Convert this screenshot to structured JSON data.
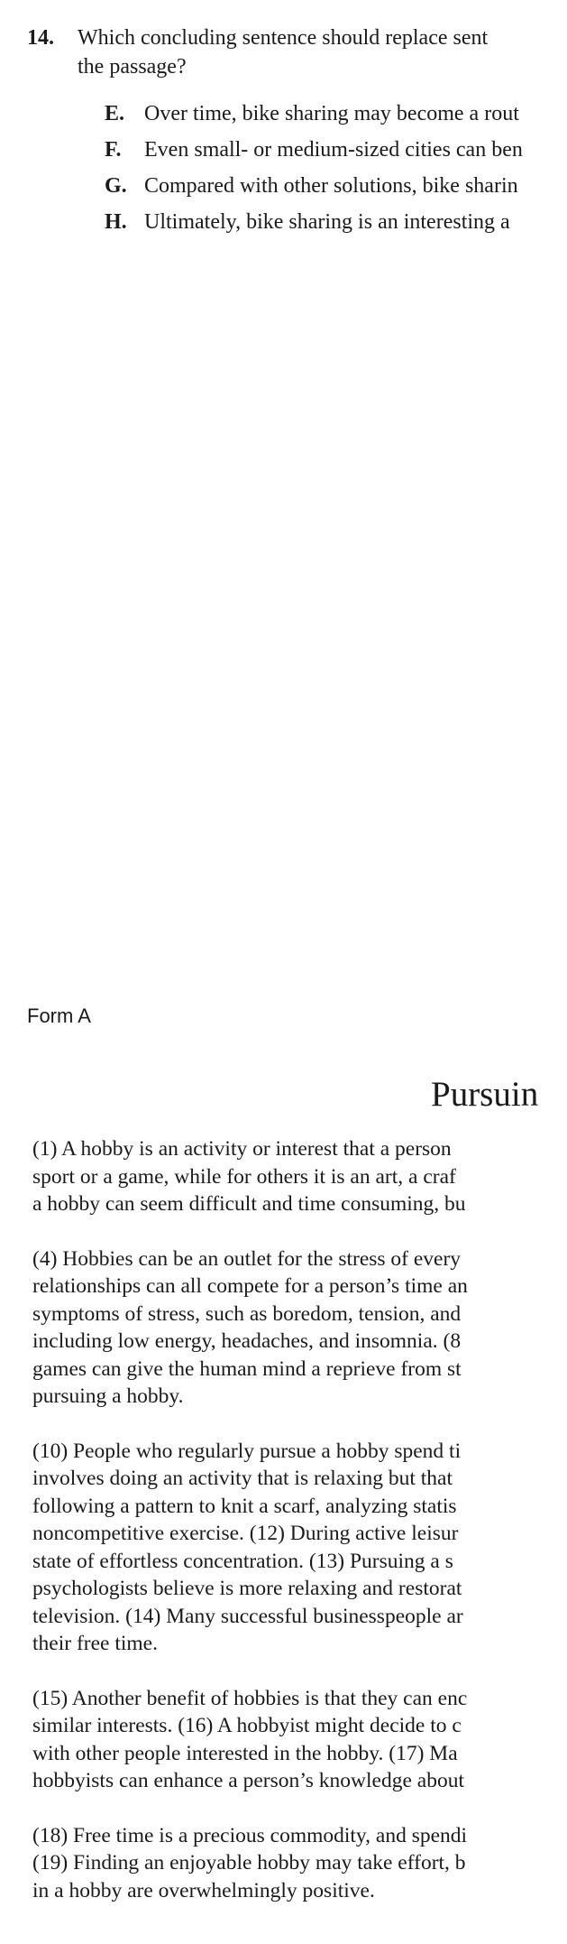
{
  "question": {
    "number": "14.",
    "stem_lines": [
      "Which concluding sentence should replace sent",
      "the passage?"
    ],
    "options": [
      {
        "letter": "E.",
        "text": "Over time, bike sharing may become a rout"
      },
      {
        "letter": "F.",
        "text": "Even small- or medium-sized cities can ben"
      },
      {
        "letter": "G.",
        "text": "Compared with other solutions, bike sharin"
      },
      {
        "letter": "H.",
        "text": "Ultimately, bike sharing is an interesting a"
      }
    ]
  },
  "form_label": "Form A",
  "passage": {
    "title": "Pursuin",
    "paragraphs": [
      [
        "(1) A hobby is an activity or interest that a person",
        "sport or a game, while for others it is an art, a craf",
        "a hobby can seem difficult and time consuming, bu"
      ],
      [
        "(4) Hobbies can be an outlet for the stress of every",
        "relationships can all compete for a person’s time an",
        "symptoms of stress, such as boredom, tension, and",
        "including low energy, headaches, and insomnia.  (8",
        "games can give the human mind a reprieve from st",
        "pursuing a hobby."
      ],
      [
        "(10) People who regularly pursue a hobby spend ti",
        "involves doing an activity that is relaxing but that",
        "following a pattern to knit a scarf, analyzing statis",
        "noncompetitive exercise.  (12) During active leisur",
        "state of effortless concentration.  (13) Pursuing a s",
        "psychologists believe is more relaxing and restorat",
        "television.  (14) Many successful businesspeople ar",
        "their free time."
      ],
      [
        "(15) Another benefit of hobbies is that they can enc",
        "similar interests.  (16) A hobbyist might decide to c",
        "with other people interested in the hobby.  (17) Ma",
        "hobbyists can enhance a person’s knowledge about"
      ],
      [
        "(18) Free time is a precious commodity, and spendi",
        "(19) Finding an enjoyable hobby may take effort, b",
        "in a hobby are overwhelmingly positive."
      ]
    ]
  }
}
